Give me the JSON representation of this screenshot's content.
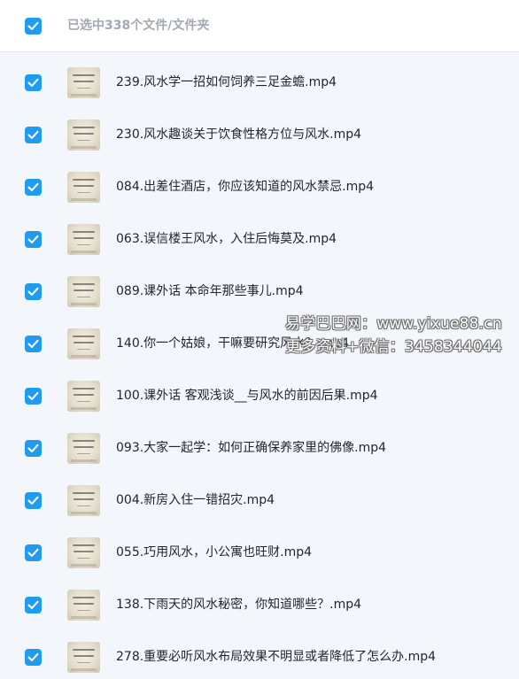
{
  "header": {
    "selected_label": "已选中338个文件/文件夹"
  },
  "files": [
    {
      "name": "239.风水学一招如何饲养三足金蟾.mp4"
    },
    {
      "name": "230.风水趣谈关于饮食性格方位与风水.mp4"
    },
    {
      "name": "084.出差住酒店，你应该知道的风水禁忌.mp4"
    },
    {
      "name": "063.误信楼王风水，入住后悔莫及.mp4"
    },
    {
      "name": "089.课外话 本命年那些事儿.mp4"
    },
    {
      "name": "140.你一个姑娘，干嘛要研究风水？.mp4"
    },
    {
      "name": "100.课外话 客观浅谈__与风水的前因后果.mp4"
    },
    {
      "name": "093.大家一起学：如何正确保养家里的佛像.mp4"
    },
    {
      "name": "004.新房入住一错招灾.mp4"
    },
    {
      "name": "055.巧用风水，小公寓也旺财.mp4"
    },
    {
      "name": "138.下雨天的风水秘密，你知道哪些？.mp4"
    },
    {
      "name": "278.重要必听风水布局效果不明显或者降低了怎么办.mp4"
    }
  ],
  "watermark": {
    "line1": "易学巴巴网：www.yixue88.cn",
    "line2": "更多资料+微信：3458344044"
  },
  "colors": {
    "accent": "#1f9cf0",
    "background": "#f3f7fc",
    "header_text": "#a2a9b3",
    "file_text": "#1d2330"
  }
}
